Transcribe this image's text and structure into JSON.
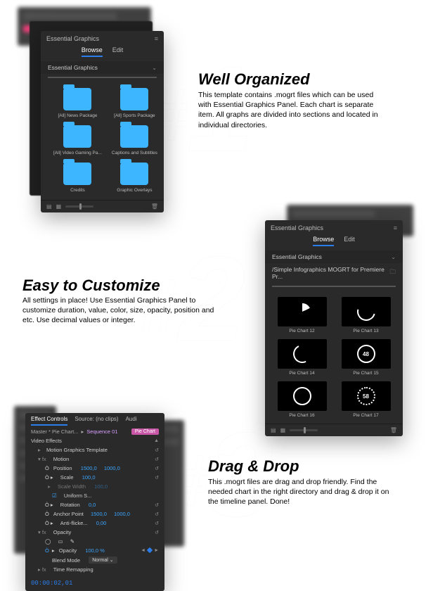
{
  "section1": {
    "title": "Well Organized",
    "body": "This template contains .mogrt files which can be used with Essential Graphics Panel. Each chart is separate item. All graphs are divided into sections and located in individual directories.",
    "panel": {
      "title": "Essential Graphics",
      "tabs": {
        "browse": "Browse",
        "edit": "Edit"
      },
      "selector": "Essential Graphics",
      "folders": [
        "[All] News Package",
        "[All] Sports Package",
        "[All] Video Gaming Pa...",
        "Captions and Subtitles",
        "Credits",
        "Graphic Overlays"
      ]
    }
  },
  "section2": {
    "title": "Easy to Customize",
    "body": "All settings in place! Use Essential Graphics Panel to customize duration, value, color, size, opacity, position and etc. Use decimal values or integer.",
    "panel": {
      "title": "Essential Graphics",
      "tabs": {
        "browse": "Browse",
        "edit": "Edit"
      },
      "selector": "Essential Graphics",
      "path": "/Simple Infographics MOGRT for Premiere Pr...",
      "thumbs": [
        {
          "label": "Pie Chart 12",
          "kind": "wedge"
        },
        {
          "label": "Pie Chart 13",
          "kind": "half",
          "val": ""
        },
        {
          "label": "Pie Chart 14",
          "kind": "q"
        },
        {
          "label": "Pie Chart 15",
          "kind": "ring",
          "val": "48"
        },
        {
          "label": "Pie Chart 16",
          "kind": "ring",
          "val": ""
        },
        {
          "label": "Pie Chart 17",
          "kind": "dotted",
          "val": "58"
        }
      ]
    }
  },
  "section3": {
    "title": "Drag & Drop",
    "body": "This .mogrt files are drag and drop friendly. Find the needed chart in the right directory and drag & drop it on the timeline panel. Done!",
    "panel": {
      "tab_effect": "Effect Controls",
      "tab_source": "Source: (no clips)",
      "tab_audi": "Audi",
      "master_label": "Master * Pie Chart...",
      "seq_link": "Sequence 01",
      "seq_chip": "Pie Chart",
      "video_effects": "Video Effects",
      "rows": [
        {
          "label": "Motion Graphics Template",
          "indent": 1,
          "drop": true
        },
        {
          "label": "Motion",
          "indent": 1,
          "fx": true,
          "drop": true
        },
        {
          "label": "Position",
          "indent": 2,
          "vals": [
            "1500,0",
            "1000,0"
          ],
          "stop": true
        },
        {
          "label": "Scale",
          "indent": 2,
          "vals": [
            "100,0"
          ],
          "stop": true
        },
        {
          "label": "Scale Width",
          "indent": 2,
          "vals": [
            "100,0"
          ],
          "dim": true
        },
        {
          "label": "Uniform S...",
          "indent": 3,
          "check": true
        },
        {
          "label": "Rotation",
          "indent": 2,
          "vals": [
            "0,0"
          ],
          "stop": true
        },
        {
          "label": "Anchor Point",
          "indent": 2,
          "vals": [
            "1500,0",
            "1000,0"
          ]
        },
        {
          "label": "Anti-flicke...",
          "indent": 2,
          "vals": [
            "0,00"
          ],
          "stop": true
        },
        {
          "label": "Opacity",
          "indent": 1,
          "fx": true,
          "drop": true
        },
        {
          "label": "",
          "indent": 2,
          "icons": true
        },
        {
          "label": "Opacity",
          "indent": 2,
          "vals": [
            "100,0 %"
          ],
          "stop": true,
          "kf": true
        },
        {
          "label": "Blend Mode",
          "indent": 3,
          "select": "Normal"
        },
        {
          "label": "Time Remapping",
          "indent": 1,
          "fx": true,
          "drop": true
        }
      ],
      "timecode": "00:00:02,01"
    }
  }
}
